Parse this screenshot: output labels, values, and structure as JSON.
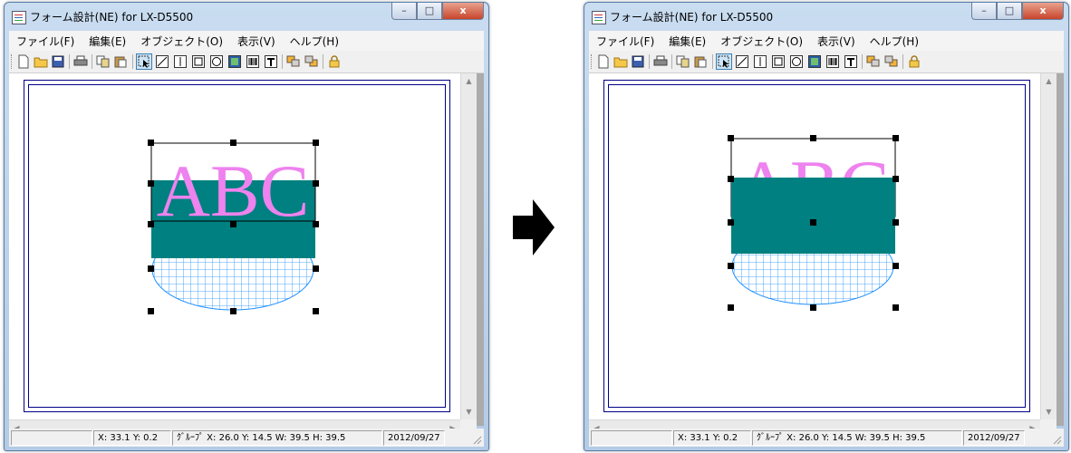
{
  "window": {
    "title": "フォーム設計(NE) for LX-D5500",
    "controls": {
      "minimize": "–",
      "maximize": "□",
      "close": "x"
    }
  },
  "menu": [
    "ファイル(F)",
    "編集(E)",
    "オブジェクト(O)",
    "表示(V)",
    "ヘルプ(H)"
  ],
  "toolbar": {
    "items": [
      "new-file",
      "open-folder",
      "save",
      "print",
      "copy",
      "paste",
      "select-pointer",
      "draw-line",
      "draw-vertical-line",
      "draw-rectangle",
      "draw-ellipse",
      "draw-image",
      "draw-barcode",
      "draw-text",
      "bring-to-front",
      "send-to-back",
      "lock"
    ],
    "active": "select-pointer"
  },
  "canvas_text": "ABC",
  "colors": {
    "text_pink": "#ee82ee",
    "fill_teal": "#008080",
    "hatch_blue": "#1e90ff",
    "border_navy": "#000088"
  },
  "status": {
    "cursor": "X: 33.1 Y: 0.2",
    "group": "ｸﾞﾙｰﾌﾟ X: 26.0 Y: 14.5 W: 39.5 H: 39.5",
    "date": "2012/09/27"
  },
  "windows": [
    {
      "name": "before",
      "stacking": "text above, teal box in middle, hatched ellipse below"
    },
    {
      "name": "after",
      "stacking": "teal box brought to front over text and ellipse"
    }
  ]
}
